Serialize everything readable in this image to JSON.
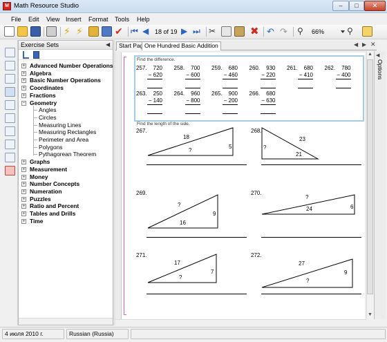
{
  "window": {
    "title": "Math Resource Studio",
    "app_icon": "pdf-app-icon"
  },
  "menu": [
    "File",
    "Edit",
    "View",
    "Insert",
    "Format",
    "Tools",
    "Help"
  ],
  "toolbar": {
    "page_counter": "18 of 19",
    "zoom": "66%"
  },
  "sets_panel": {
    "title": "Exercise Sets",
    "items": [
      {
        "label": "Advanced Number Operations",
        "level": 0,
        "bold": true
      },
      {
        "label": "Algebra",
        "level": 0,
        "bold": true
      },
      {
        "label": "Basic Number Operations",
        "level": 0,
        "bold": true
      },
      {
        "label": "Coordinates",
        "level": 0,
        "bold": true
      },
      {
        "label": "Fractions",
        "level": 0,
        "bold": true
      },
      {
        "label": "Geometry",
        "level": 0,
        "bold": true,
        "expanded": true
      },
      {
        "label": "Angles",
        "level": 1
      },
      {
        "label": "Circles",
        "level": 1
      },
      {
        "label": "Measuring Lines",
        "level": 1
      },
      {
        "label": "Measuring Rectangles",
        "level": 1
      },
      {
        "label": "Perimeter and Area",
        "level": 1
      },
      {
        "label": "Polygons",
        "level": 1
      },
      {
        "label": "Pythagorean Theorem",
        "level": 1
      },
      {
        "label": "Graphs",
        "level": 0,
        "bold": true
      },
      {
        "label": "Measurement",
        "level": 0,
        "bold": true
      },
      {
        "label": "Money",
        "level": 0,
        "bold": true
      },
      {
        "label": "Number Concepts",
        "level": 0,
        "bold": true
      },
      {
        "label": "Numeration",
        "level": 0,
        "bold": true
      },
      {
        "label": "Puzzles",
        "level": 0,
        "bold": true
      },
      {
        "label": "Ratio and Percent",
        "level": 0,
        "bold": true
      },
      {
        "label": "Tables and Drills",
        "level": 0,
        "bold": true
      },
      {
        "label": "Time",
        "level": 0,
        "bold": true
      }
    ]
  },
  "tabs": [
    {
      "label": "Start Page"
    },
    {
      "label": "One Hundred Basic Addition",
      "active": true
    }
  ],
  "options_label": "Options",
  "subtraction": {
    "instruction": "Find the difference.",
    "row1": [
      {
        "num": "257.",
        "top": "720",
        "bottom": "− 620"
      },
      {
        "num": "258.",
        "top": "700",
        "bottom": "− 600"
      },
      {
        "num": "259.",
        "top": "680",
        "bottom": "− 460"
      },
      {
        "num": "260.",
        "top": "930",
        "bottom": "− 220"
      },
      {
        "num": "261.",
        "top": "680",
        "bottom": "− 410"
      },
      {
        "num": "262.",
        "top": "780",
        "bottom": "− 400"
      }
    ],
    "row2": [
      {
        "num": "263.",
        "top": "250",
        "bottom": "− 140"
      },
      {
        "num": "264.",
        "top": "960",
        "bottom": "− 800"
      },
      {
        "num": "265.",
        "top": "900",
        "bottom": "− 200"
      },
      {
        "num": "266.",
        "top": "680",
        "bottom": "− 630"
      }
    ]
  },
  "triangles": {
    "instruction": "Find the length of the side.",
    "items": [
      {
        "num": "267.",
        "hyp": "18",
        "leg": "5",
        "unknown": "?"
      },
      {
        "num": "268.",
        "hyp": "23",
        "leg": "21",
        "unknown": "?"
      },
      {
        "num": "269.",
        "hyp": "?",
        "leg_v": "9",
        "leg_h": "16"
      },
      {
        "num": "270.",
        "hyp": "?",
        "leg_v": "6",
        "leg_h": "24"
      },
      {
        "num": "271.",
        "hyp": "17",
        "leg_v": "7",
        "unknown": "?"
      },
      {
        "num": "272.",
        "hyp": "27",
        "leg_v": "9",
        "unknown": "?"
      }
    ]
  },
  "status": {
    "date": "4 июля 2010 г.",
    "language": "Russian (Russia)"
  }
}
